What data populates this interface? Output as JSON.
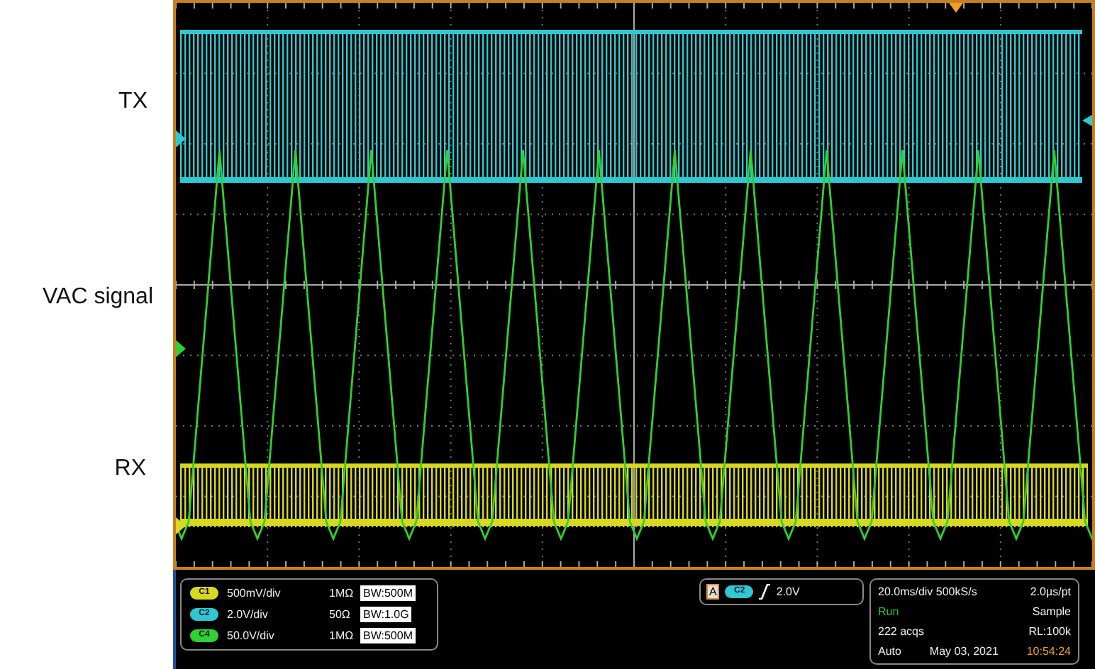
{
  "trace_labels": [
    {
      "text": "TX",
      "kind": "tx"
    },
    {
      "text": "VAC signal",
      "kind": "vac"
    },
    {
      "text": "RX",
      "kind": "rx"
    }
  ],
  "channels": [
    {
      "badge": "C1",
      "color": "#d8d820",
      "scale": "500mV/div",
      "impedance": "1MΩ",
      "bandwidth": "BW:500M"
    },
    {
      "badge": "C2",
      "color": "#30c8d0",
      "scale": "2.0V/div",
      "impedance": "50Ω",
      "bandwidth": "BW:1.0G"
    },
    {
      "badge": "C4",
      "color": "#30d030",
      "scale": "50.0V/div",
      "impedance": "1MΩ",
      "bandwidth": "BW:500M"
    }
  ],
  "trigger": {
    "label": "A",
    "source": "C2",
    "level": "2.0V"
  },
  "acquisition": [
    [
      {
        "text": "20.0ms/div 500kS/s",
        "kind": "text"
      },
      {
        "text": "2.0µs/pt",
        "kind": "text"
      }
    ],
    [
      {
        "text": "Run",
        "kind": "status"
      },
      {
        "text": "Sample",
        "kind": "text"
      }
    ],
    [
      {
        "text": "222 acqs",
        "kind": "text"
      },
      {
        "text": "RL:100k",
        "kind": "text"
      }
    ],
    [
      {
        "text": "Auto",
        "kind": "text"
      },
      {
        "text": "May 03, 2021",
        "kind": "text"
      },
      {
        "text": "10:54:24",
        "kind": "time"
      }
    ]
  ]
}
